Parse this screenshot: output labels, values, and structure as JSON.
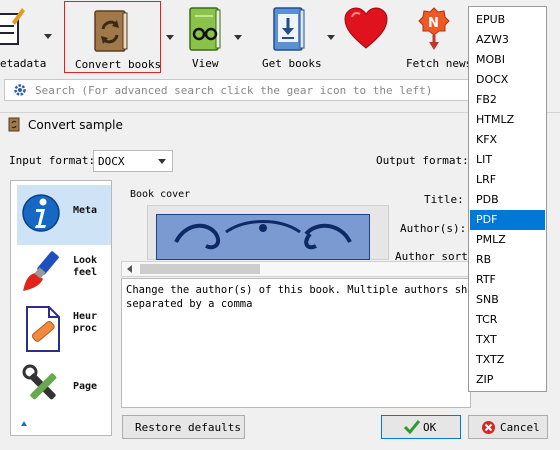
{
  "toolbar": {
    "metadata_label": "etadata",
    "convert_label": "Convert books",
    "view_label": "View",
    "get_books_label": "Get books",
    "fetch_news_label": "Fetch news"
  },
  "search": {
    "placeholder": "Search (For advanced search click the gear icon to the left)"
  },
  "dialog": {
    "title": "Convert sample",
    "input_format_label": "Input format:",
    "input_format_value": "DOCX",
    "output_format_label": "Output format:",
    "sidebar": [
      {
        "label": "Meta"
      },
      {
        "label": "Look\nfeel"
      },
      {
        "label": "Heur\nproc"
      },
      {
        "label": "Page"
      }
    ],
    "book_cover_label": "Book cover",
    "title_label": "Title:",
    "authors_label": "Author(s):",
    "author_sort_label": "Author sort:",
    "help_text": "Change the author(s) of this book. Multiple authors shoul\nseparated by a comma",
    "restore_defaults": "Restore defaults",
    "ok": "OK",
    "cancel": "Cancel"
  },
  "format_dropdown": {
    "options": [
      "EPUB",
      "AZW3",
      "MOBI",
      "DOCX",
      "FB2",
      "HTMLZ",
      "KFX",
      "LIT",
      "LRF",
      "PDB",
      "PDF",
      "PMLZ",
      "RB",
      "RTF",
      "SNB",
      "TCR",
      "TXT",
      "TXTZ",
      "ZIP"
    ],
    "selected": "PDF"
  },
  "colors": {
    "highlight": "#0078d7",
    "convert_border": "#dd2222"
  }
}
